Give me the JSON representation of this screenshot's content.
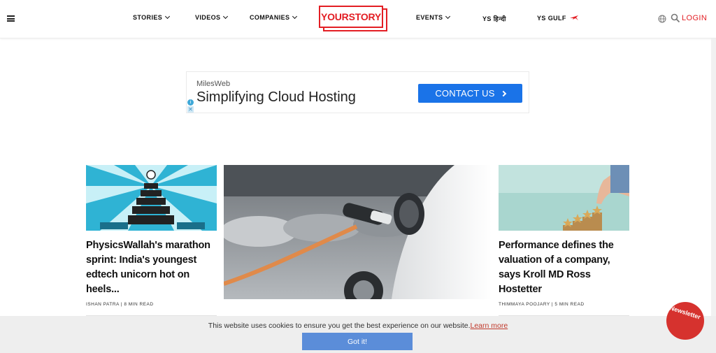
{
  "nav": {
    "items": [
      {
        "label": "STORIES",
        "has_dropdown": true
      },
      {
        "label": "VIDEOS",
        "has_dropdown": true
      },
      {
        "label": "COMPANIES",
        "has_dropdown": true
      },
      {
        "label": "EVENTS",
        "has_dropdown": true
      },
      {
        "label": "YS हिन्दी",
        "has_dropdown": false
      },
      {
        "label": "YS GULF",
        "has_dropdown": false
      }
    ],
    "logo_text": "YOURSTORY",
    "login_label": "LOGIN",
    "brand_color": "#e31e24",
    "icons": [
      "hamburger-icon",
      "globe-icon",
      "search-icon",
      "plane-icon"
    ]
  },
  "ad": {
    "brand": "MilesWeb",
    "headline": "Simplifying Cloud Hosting",
    "cta_label": "CONTACT US",
    "cta_color": "#1a73e8"
  },
  "articles": [
    {
      "title": "PhysicsWallah's marathon sprint: India's youngest edtech unicorn hot on heels...",
      "meta": "ISHAN PATRA | 8 MIN READ"
    },
    {
      "title": "Performance defines the valuation of a company, says Kroll MD Ross Hostetter",
      "meta": "THIMMAYA POOJARY | 5 MIN READ"
    }
  ],
  "cookie": {
    "text": "This website uses cookies to ensure you get the best experience on our website.",
    "link_label": "Learn more",
    "button_label": "Got it!",
    "button_color": "#5b8dd9"
  },
  "newsletter": {
    "label": "Newsletter"
  }
}
